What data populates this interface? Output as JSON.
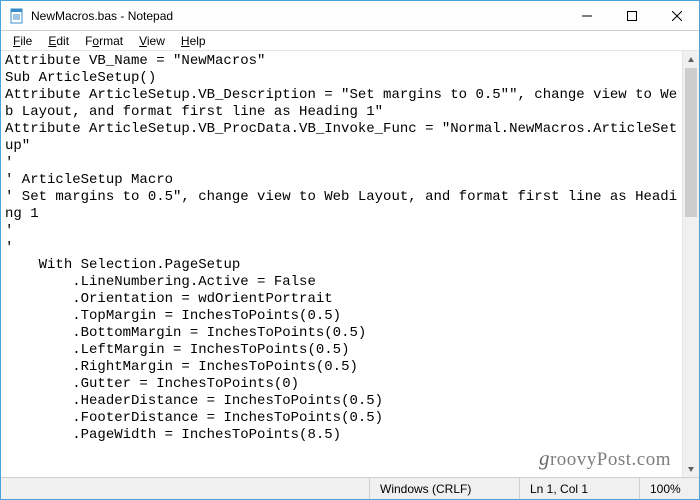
{
  "window": {
    "title": "NewMacros.bas - Notepad"
  },
  "menubar": {
    "items": [
      {
        "label": "File",
        "accel": "F"
      },
      {
        "label": "Edit",
        "accel": "E"
      },
      {
        "label": "Format",
        "accel": "o"
      },
      {
        "label": "View",
        "accel": "V"
      },
      {
        "label": "Help",
        "accel": "H"
      }
    ]
  },
  "editor": {
    "content": "Attribute VB_Name = \"NewMacros\"\nSub ArticleSetup()\nAttribute ArticleSetup.VB_Description = \"Set margins to 0.5\"\", change view to Web Layout, and format first line as Heading 1\"\nAttribute ArticleSetup.VB_ProcData.VB_Invoke_Func = \"Normal.NewMacros.ArticleSetup\"\n'\n' ArticleSetup Macro\n' Set margins to 0.5\", change view to Web Layout, and format first line as Heading 1\n'\n'\n    With Selection.PageSetup\n        .LineNumbering.Active = False\n        .Orientation = wdOrientPortrait\n        .TopMargin = InchesToPoints(0.5)\n        .BottomMargin = InchesToPoints(0.5)\n        .LeftMargin = InchesToPoints(0.5)\n        .RightMargin = InchesToPoints(0.5)\n        .Gutter = InchesToPoints(0)\n        .HeaderDistance = InchesToPoints(0.5)\n        .FooterDistance = InchesToPoints(0.5)\n        .PageWidth = InchesToPoints(8.5)"
  },
  "statusbar": {
    "lineending": "Windows (CRLF)",
    "position": "Ln 1, Col 1",
    "zoom": "100%"
  },
  "watermark": "groovyPost.com"
}
